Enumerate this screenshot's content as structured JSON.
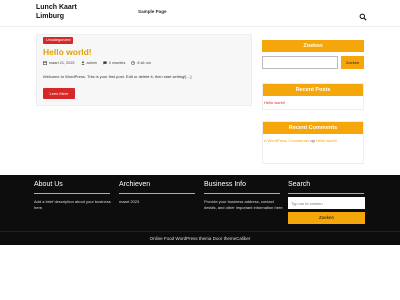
{
  "site": {
    "title_line1": "Lunch Kaart",
    "title_line2": "Limburg"
  },
  "nav": {
    "items": [
      {
        "label": "Sample Page"
      }
    ]
  },
  "icons": {
    "search": "search-icon",
    "calendar": "calendar-icon",
    "user": "user-icon",
    "comment": "comment-icon",
    "clock": "clock-icon"
  },
  "colors": {
    "accent": "#f5a60a",
    "red": "#d62828",
    "footer_bg": "#0d0d0d"
  },
  "post": {
    "category": "Uncategorized",
    "title": "Hello world!",
    "date": "maart 21, 2023",
    "author": "admin",
    "comments": "0 reacties",
    "read_time": "8 s6 um",
    "excerpt": "Welcome to WordPress. This is your first post. Edit or delete it, then start writing![…]",
    "read_more": "Lees Meer"
  },
  "sidebar": {
    "search": {
      "title": "Zoeken",
      "placeholder": "",
      "button": "Zoeken"
    },
    "recent_posts": {
      "title": "Recent Posts",
      "items": [
        {
          "label": "Hello world!"
        }
      ]
    },
    "recent_comments": {
      "title": "Recent Comments",
      "items": [
        {
          "author": "A WordPress Commenter",
          "connector": "op",
          "post": "Hello world!"
        }
      ]
    }
  },
  "footer": {
    "about": {
      "title": "About Us",
      "text": "Add a brief description about your business here."
    },
    "archive": {
      "title": "Archieven",
      "items": [
        {
          "label": "maart 2023"
        }
      ]
    },
    "business": {
      "title": "Business Info",
      "text": "Provide your business address, contact details, and other important information here."
    },
    "search": {
      "title": "Search",
      "placeholder": "Typ om te zoeken",
      "button": "Zoeken"
    },
    "credit": "Online Food WordPress thema Door themeCaliber"
  }
}
